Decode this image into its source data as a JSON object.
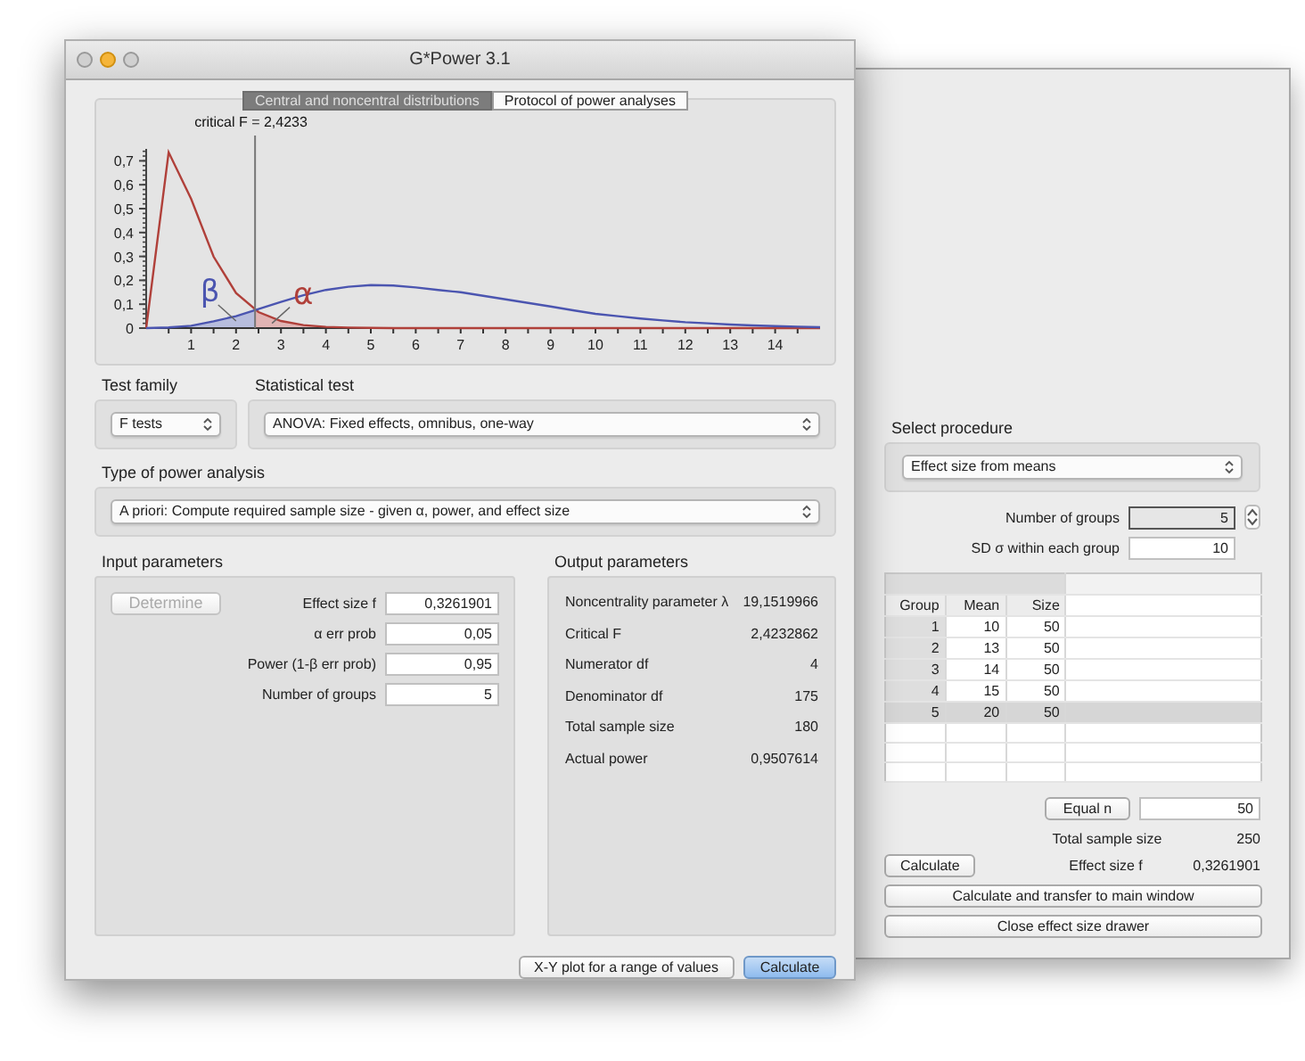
{
  "window": {
    "title": "G*Power 3.1"
  },
  "tabs": [
    {
      "label": "Central and noncentral distributions",
      "selected": true
    },
    {
      "label": "Protocol of power analyses",
      "selected": false
    }
  ],
  "distribution_plot": {
    "chart_data": {
      "type": "line",
      "x": [
        0,
        0.5,
        1,
        1.5,
        2,
        2.5,
        3,
        3.5,
        4,
        4.5,
        5,
        5.5,
        6,
        6.5,
        7,
        7.5,
        8,
        8.5,
        9,
        9.5,
        10,
        10.5,
        11,
        11.5,
        12,
        12.5,
        13,
        13.5,
        14,
        14.5,
        15
      ],
      "series": [
        {
          "color": "#b0403a",
          "values": [
            0,
            0.736,
            0.541,
            0.299,
            0.147,
            0.067,
            0.03,
            0.013,
            0.005,
            0.002,
            0.001,
            0,
            0,
            0,
            0,
            0,
            0,
            0,
            0,
            0,
            0,
            0,
            0,
            0,
            0,
            0,
            0,
            0,
            0,
            0,
            0
          ]
        },
        {
          "color": "#4b55b0",
          "values": [
            0,
            0.003,
            0.01,
            0.028,
            0.05,
            0.08,
            0.11,
            0.137,
            0.16,
            0.173,
            0.18,
            0.178,
            0.17,
            0.16,
            0.15,
            0.135,
            0.12,
            0.105,
            0.09,
            0.075,
            0.06,
            0.05,
            0.04,
            0.032,
            0.025,
            0.02,
            0.015,
            0.011,
            0.008,
            0.006,
            0.004
          ]
        }
      ],
      "xlim": [
        0,
        15
      ],
      "ylim": [
        0,
        0.75
      ],
      "xticks": [
        1,
        2,
        3,
        4,
        5,
        6,
        7,
        8,
        9,
        10,
        11,
        12,
        13,
        14
      ],
      "yticks": [
        0,
        {
          "value": 0.1,
          "label": "0,1"
        },
        {
          "value": 0.2,
          "label": "0,2"
        },
        {
          "value": 0.3,
          "label": "0,3"
        },
        {
          "value": 0.4,
          "label": "0,4"
        },
        {
          "value": 0.5,
          "label": "0,5"
        },
        {
          "value": 0.6,
          "label": "0,6"
        },
        {
          "value": 0.7,
          "label": "0,7"
        }
      ],
      "ref_lines": [
        {
          "axis": "x",
          "value": 2.4233,
          "label": "critical F = 2,4233",
          "color": "#777777"
        }
      ],
      "annotations": [
        {
          "text": "β",
          "x": 2,
          "y": 0.03
        },
        {
          "text": "α",
          "x": 2.8,
          "y": 0.02
        }
      ]
    }
  },
  "test_family": {
    "label": "Test family",
    "value": "F tests"
  },
  "statistical_test": {
    "label": "Statistical test",
    "value": "ANOVA: Fixed effects, omnibus, one-way"
  },
  "power_analysis": {
    "label": "Type of power analysis",
    "value": "A priori: Compute required sample size - given α, power, and effect size"
  },
  "input_parameters": {
    "title": "Input parameters",
    "determine_button": {
      "label": "Determine",
      "disabled": true
    },
    "fields": [
      {
        "label": "Effect size f",
        "value": "0,3261901"
      },
      {
        "label": "α err prob",
        "value": "0,05"
      },
      {
        "label": "Power (1-β err prob)",
        "value": "0,95"
      },
      {
        "label": "Number of groups",
        "value": "5"
      }
    ]
  },
  "output_parameters": {
    "title": "Output parameters",
    "rows": [
      {
        "label": "Noncentrality parameter λ",
        "value": "19,1519966"
      },
      {
        "label": "Critical F",
        "value": "2,4232862"
      },
      {
        "label": "Numerator df",
        "value": "4"
      },
      {
        "label": "Denominator df",
        "value": "175"
      },
      {
        "label": "Total sample size",
        "value": "180"
      },
      {
        "label": "Actual power",
        "value": "0,9507614"
      }
    ]
  },
  "buttons": [
    {
      "label": "X-Y plot for a range of values",
      "default": false
    },
    {
      "label": "Calculate",
      "default": true
    }
  ],
  "drawer": {
    "procedure": {
      "label": "Select procedure",
      "value": "Effect size from means"
    },
    "fields": [
      {
        "label": "Number of groups",
        "value": "5",
        "focused": true,
        "stepper": true
      },
      {
        "label": "SD σ within each group",
        "value": "10",
        "focused": false,
        "stepper": false
      }
    ],
    "table": {
      "columns": [
        "Group",
        "Mean",
        "Size"
      ],
      "rows": [
        {
          "cells": [
            "1",
            "10",
            "50"
          ],
          "selected": false
        },
        {
          "cells": [
            "2",
            "13",
            "50"
          ],
          "selected": false
        },
        {
          "cells": [
            "3",
            "14",
            "50"
          ],
          "selected": false
        },
        {
          "cells": [
            "4",
            "15",
            "50"
          ],
          "selected": false
        },
        {
          "cells": [
            "5",
            "20",
            "50"
          ],
          "selected": true
        }
      ]
    },
    "equal_n": {
      "label": "Equal n",
      "value": "50"
    },
    "total": {
      "label": "Total sample size",
      "value": "250"
    },
    "calculate_button": "Calculate",
    "effect": {
      "label": "Effect size f",
      "value": "0,3261901"
    },
    "buttons": [
      "Calculate and transfer to main window",
      "Close effect size drawer"
    ]
  }
}
